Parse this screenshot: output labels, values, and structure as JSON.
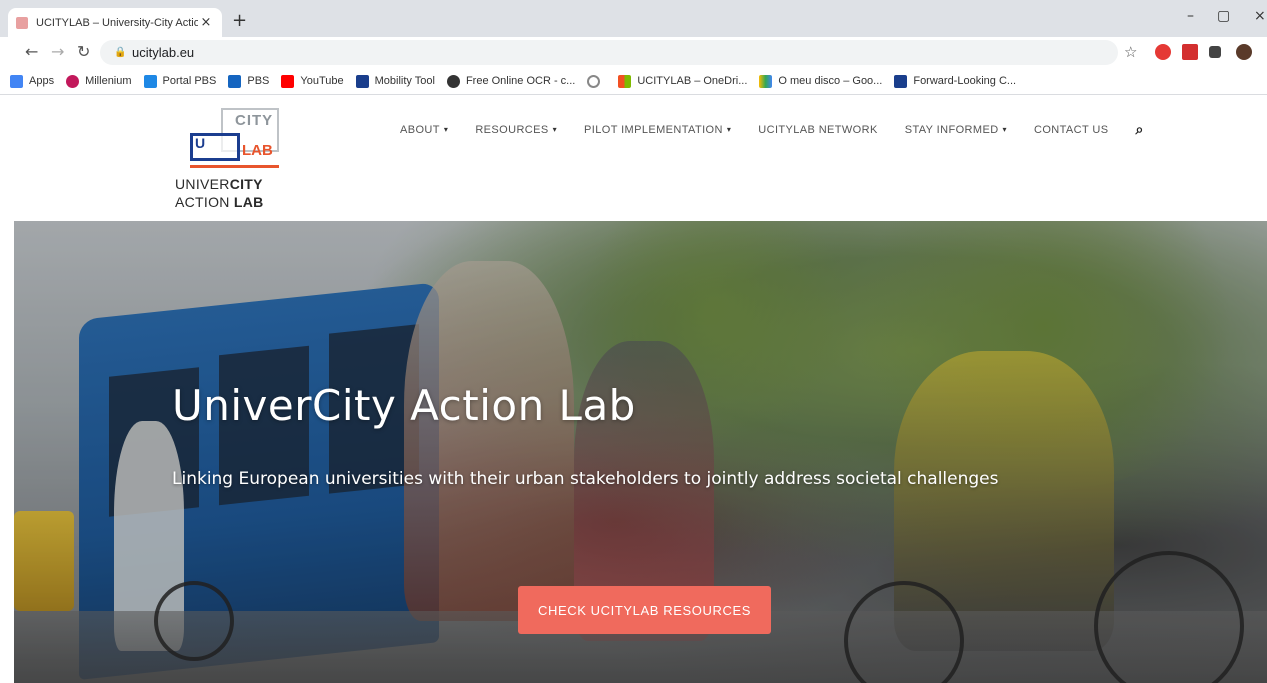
{
  "browser": {
    "tab_title": "UCITYLAB – University-City Actio",
    "tab_close": "×",
    "new_tab": "+",
    "url": "ucitylab.eu",
    "window_controls": [
      "–",
      "▢",
      "×"
    ]
  },
  "bookmarks": [
    {
      "label": "Apps",
      "color": "#4285f4"
    },
    {
      "label": "Millenium",
      "color": "#c2185b"
    },
    {
      "label": "Portal PBS",
      "color": "#1e88e5"
    },
    {
      "label": "PBS",
      "color": "#1565c0"
    },
    {
      "label": "YouTube",
      "color": "#ff0000"
    },
    {
      "label": "Mobility Tool",
      "color": "#1a3e8c"
    },
    {
      "label": "Free Online OCR - c...",
      "color": "#333333"
    },
    {
      "label": "",
      "color": "#888888"
    },
    {
      "label": "UCITYLAB – OneDri...",
      "color": "#f25022"
    },
    {
      "label": "O meu disco – Goo...",
      "color": "#34a853"
    },
    {
      "label": "Forward-Looking C...",
      "color": "#1a3e8c"
    }
  ],
  "logo": {
    "city": "CITY",
    "u": "U",
    "lab": "LAB",
    "line1_a": "UNIVER",
    "line1_b": "CITY",
    "line2_a": "ACTION ",
    "line2_b": "LAB"
  },
  "nav": {
    "about": "ABOUT",
    "resources": "RESOURCES",
    "pilot": "PILOT IMPLEMENTATION",
    "network": "UCITYLAB NETWORK",
    "stay": "STAY INFORMED",
    "contact": "CONTACT US"
  },
  "hero": {
    "title": "UniverCity Action Lab",
    "subtitle": "Linking European universities with their urban stakeholders to jointly address societal challenges",
    "button": "CHECK UCITYLAB RESOURCES"
  },
  "colors": {
    "accent": "#f06a5d",
    "logo_blue": "#1b3d8f",
    "logo_orange": "#e8552d"
  }
}
